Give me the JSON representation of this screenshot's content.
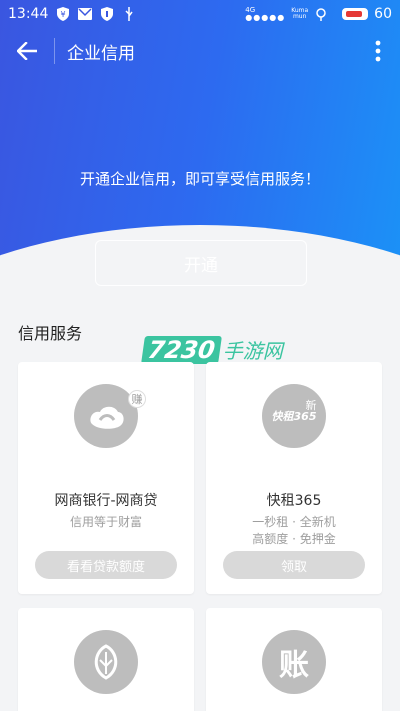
{
  "status_bar": {
    "time": "13:44",
    "network": "4G",
    "carrier": "Kuma",
    "carrier_sub": "mun",
    "signal_dots": "●●●●●",
    "battery_level": "60",
    "battery_color": "#e53935"
  },
  "app_bar": {
    "title": "企业信用",
    "back_icon": "arrow-left-icon",
    "more_icon": "more-vert-icon"
  },
  "hero": {
    "promo_text": "开通企业信用，即可享受信用服务！",
    "open_button_label": "开通",
    "gradient_start": "#3a56e0",
    "gradient_end": "#1b92f7"
  },
  "watermark": {
    "number": "7230",
    "text": "手游网"
  },
  "credit_services": {
    "section_title": "信用服务",
    "cards": [
      {
        "name": "网商银行-网商贷",
        "desc_line1": "信用等于财富",
        "desc_line2": "",
        "button_label": "看看贷款额度",
        "badge": "赚"
      },
      {
        "name": "快租365",
        "desc_line1": "一秒租 · 全新机",
        "desc_line2": "高额度 · 免押金",
        "button_label": "领取",
        "badge": "新",
        "logo_text": "快租365"
      },
      {
        "name": "",
        "logo_icon": "seed-icon"
      },
      {
        "name": "",
        "logo_text": "账"
      }
    ]
  }
}
